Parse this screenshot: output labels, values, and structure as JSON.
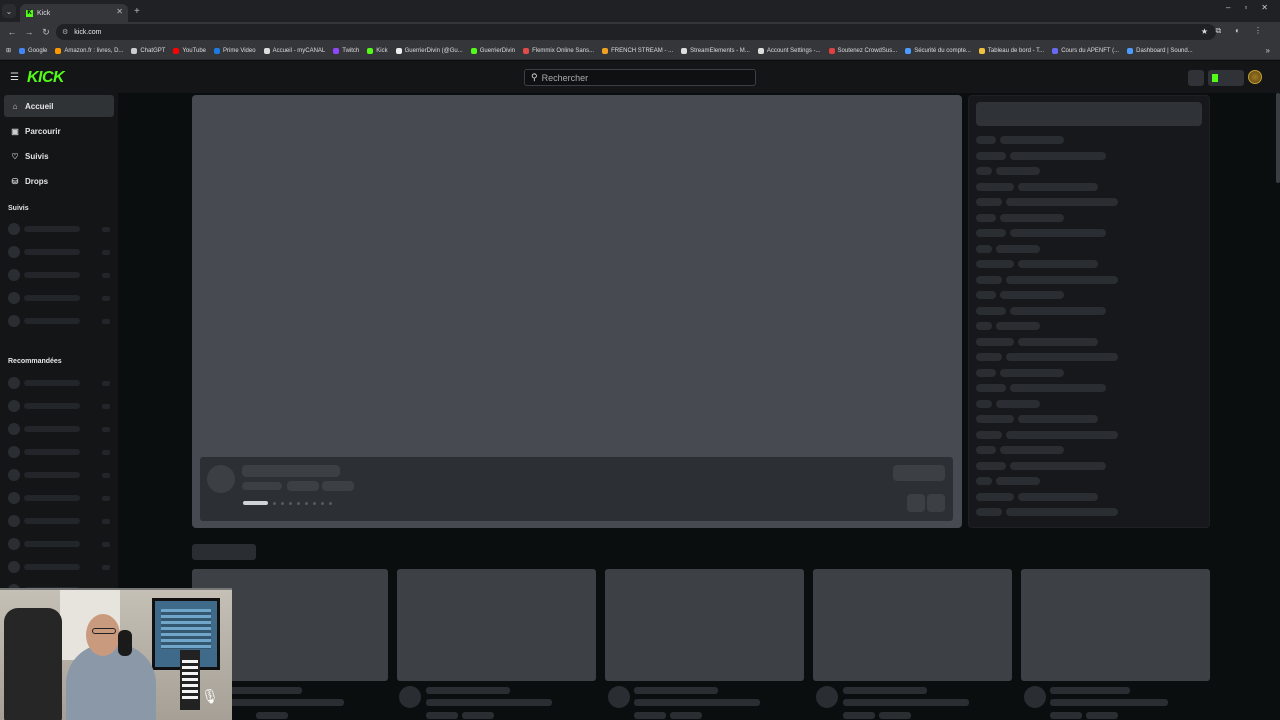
{
  "browser": {
    "tab_title": "Kick",
    "tab_favicon": "K",
    "new_tab": "+",
    "url": "kick.com",
    "bookmarks": [
      {
        "label": "Google",
        "color": "#4285f4"
      },
      {
        "label": "Amazon.fr : livres, D...",
        "color": "#ff9900"
      },
      {
        "label": "ChatGPT",
        "color": "#cccccc"
      },
      {
        "label": "YouTube",
        "color": "#ff0000"
      },
      {
        "label": "Prime Video",
        "color": "#1f7ae0"
      },
      {
        "label": "Accueil - myCANAL",
        "color": "#dddddd"
      },
      {
        "label": "Twitch",
        "color": "#9146ff"
      },
      {
        "label": "Kick",
        "color": "#53fc18"
      },
      {
        "label": "GuerrierDivin (@Gu...",
        "color": "#eeeeee"
      },
      {
        "label": "GuerrierDivin",
        "color": "#53fc18"
      },
      {
        "label": "Flemmix Online Sans...",
        "color": "#e34b4b"
      },
      {
        "label": "FRENCH STREAM - ...",
        "color": "#f0a020"
      },
      {
        "label": "StreamElements - M...",
        "color": "#dddddd"
      },
      {
        "label": "Account Settings -...",
        "color": "#dddddd"
      },
      {
        "label": "Soutenez CrowdSus...",
        "color": "#e04040"
      },
      {
        "label": "Sécurité du compte...",
        "color": "#4a9cff"
      },
      {
        "label": "Tableau de bord - T...",
        "color": "#f0c040"
      },
      {
        "label": "Cours du APENFT (...",
        "color": "#6a6af0"
      },
      {
        "label": "Dashboard | Sound...",
        "color": "#4a9cff"
      }
    ]
  },
  "header": {
    "logo": "KICK",
    "search_placeholder": "Rechercher"
  },
  "sidebar": {
    "items": [
      {
        "label": "Accueil",
        "icon": "home-icon",
        "glyph": "⌂"
      },
      {
        "label": "Parcourir",
        "icon": "browse-icon",
        "glyph": "▣"
      },
      {
        "label": "Suivis",
        "icon": "heart-icon",
        "glyph": "♡"
      },
      {
        "label": "Drops",
        "icon": "gift-icon",
        "glyph": "⛁"
      }
    ],
    "section_following": "Suivis",
    "section_recommended": "Recommandées"
  },
  "colors": {
    "brand": "#53fc18",
    "skeleton": "#474b51"
  }
}
